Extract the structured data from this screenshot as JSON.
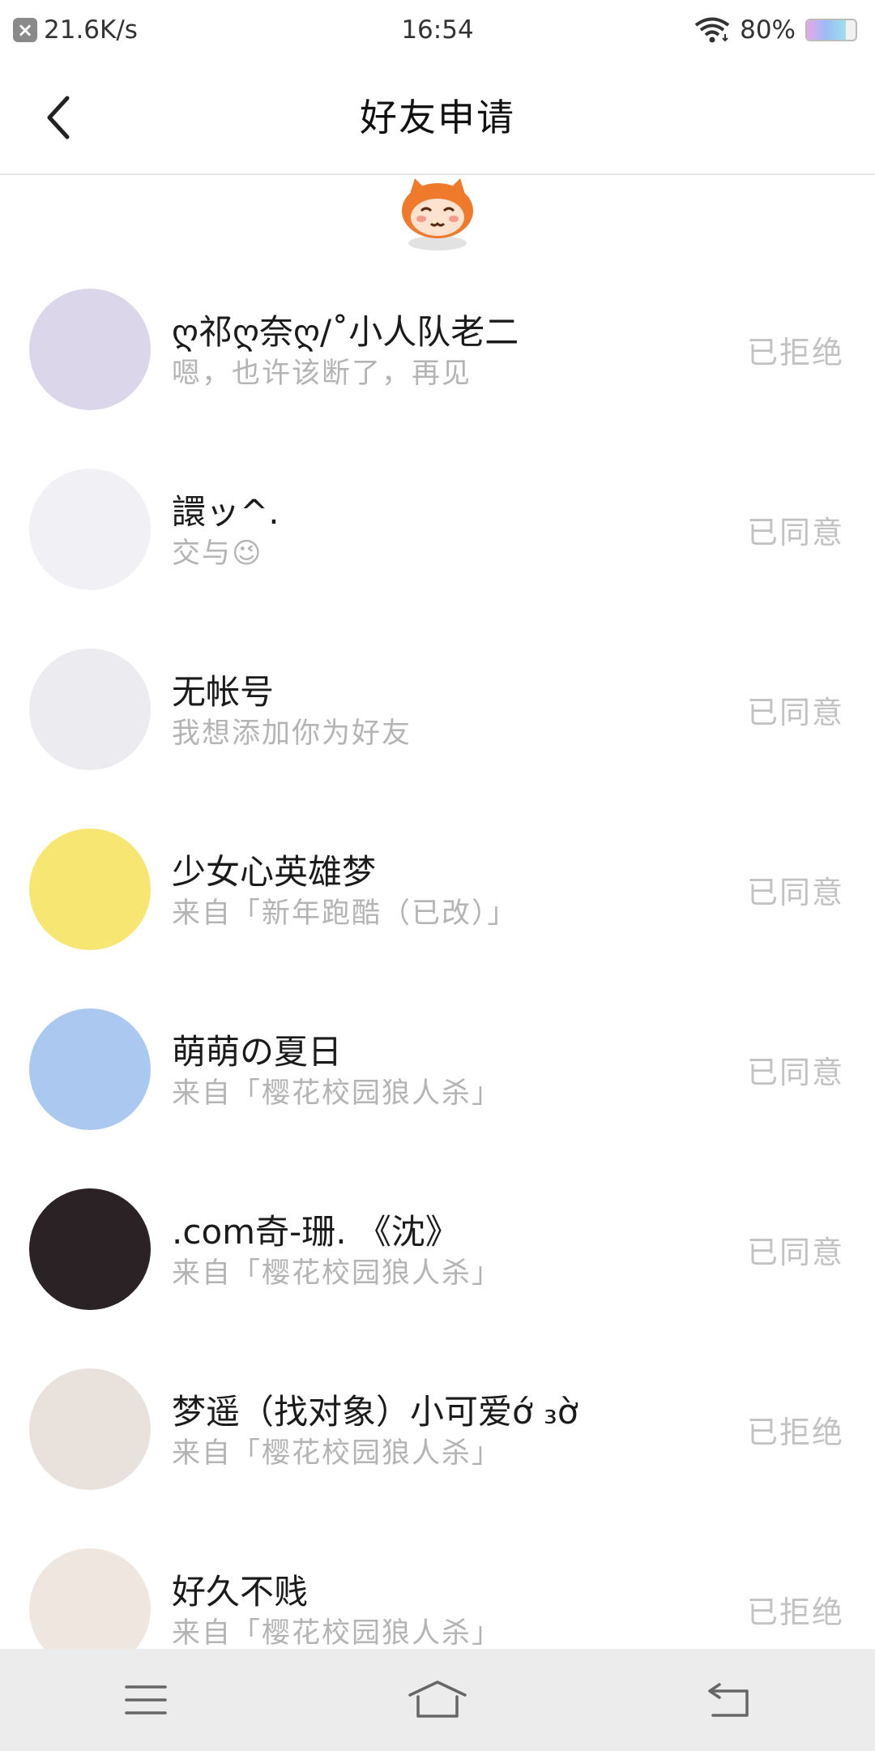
{
  "status_bar": {
    "speed": "21.6K/s",
    "time": "16:54",
    "battery": "80%",
    "battery_level": 0.8
  },
  "header": {
    "title": "好友申请"
  },
  "requests": [
    {
      "name": "ღ祁ღ奈ღ/˚小人队老二",
      "message": "嗯，也许该断了，再见",
      "status": "已拒绝",
      "avatar_color": "#dcd6ea"
    },
    {
      "name": "譞ッ^.",
      "message": "交与😉",
      "status": "已同意",
      "avatar_color": "#f1f0f4"
    },
    {
      "name": "无帐号",
      "message": "我想添加你为好友",
      "status": "已同意",
      "avatar_color": "#ececf0"
    },
    {
      "name": "少女心英雄梦",
      "message": "来自「新年跑酷（已改）」",
      "status": "已同意",
      "avatar_color": "#f7e772"
    },
    {
      "name": "萌萌の夏日",
      "message": "来自「樱花校园狼人杀」",
      "status": "已同意",
      "avatar_color": "#aac8f0"
    },
    {
      "name": ".com奇-珊.  《沈》",
      "message": "来自「樱花校园狼人杀」",
      "status": "已同意",
      "avatar_color": "#2a2224"
    },
    {
      "name": "梦遥（找对象）小可爱ớ ₃ờ",
      "message": "来自「樱花校园狼人杀」",
      "status": "已拒绝",
      "avatar_color": "#e9e2dc"
    },
    {
      "name": "好久不贱",
      "message": "来自「樱花校园狼人杀」",
      "status": "已拒绝",
      "avatar_color": "#efe6df"
    }
  ],
  "icons": {
    "back": "chevron-left-icon",
    "menu": "menu-icon",
    "home": "home-icon",
    "return": "return-icon",
    "wifi": "wifi-icon",
    "mascot": "monkey-mascot-icon"
  }
}
